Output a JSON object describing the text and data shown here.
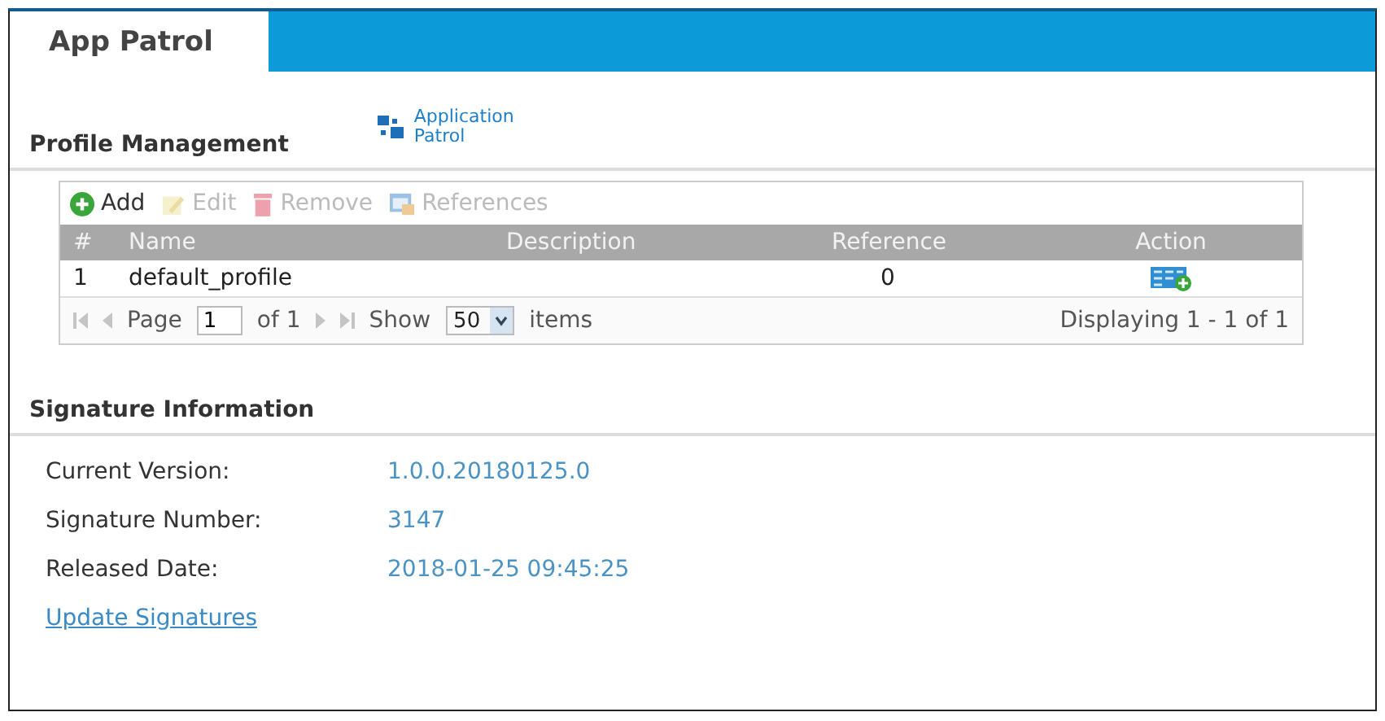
{
  "tabs": [
    {
      "label": "App Patrol",
      "selected": true
    }
  ],
  "profile_management": {
    "title": "Profile Management",
    "app_link": "Application\nPatrol",
    "toolbar": [
      {
        "kind": "add",
        "label": "Add",
        "disabled": false
      },
      {
        "kind": "edit",
        "label": "Edit",
        "disabled": true
      },
      {
        "kind": "remove",
        "label": "Remove",
        "disabled": true
      },
      {
        "kind": "references",
        "label": "References",
        "disabled": true
      }
    ],
    "table": {
      "columns": [
        "#",
        "Name",
        "Description",
        "Reference",
        "Action"
      ],
      "rows": [
        {
          "index": "1",
          "name": "default_profile",
          "description": "",
          "reference": "0"
        }
      ]
    },
    "pager": {
      "page_label": "Page",
      "page": "1",
      "of": "of 1",
      "show": "Show",
      "per_page": "50",
      "items": "items",
      "displaying": "Displaying 1 - 1 of 1"
    }
  },
  "signature_information": {
    "title": "Signature Information",
    "fields": [
      {
        "label": "Current Version:",
        "value": "1.0.0.20180125.0"
      },
      {
        "label": "Signature Number:",
        "value": "3147"
      },
      {
        "label": "Released Date:",
        "value": "2018-01-25 09:45:25"
      }
    ],
    "update_link": "Update Signatures"
  }
}
